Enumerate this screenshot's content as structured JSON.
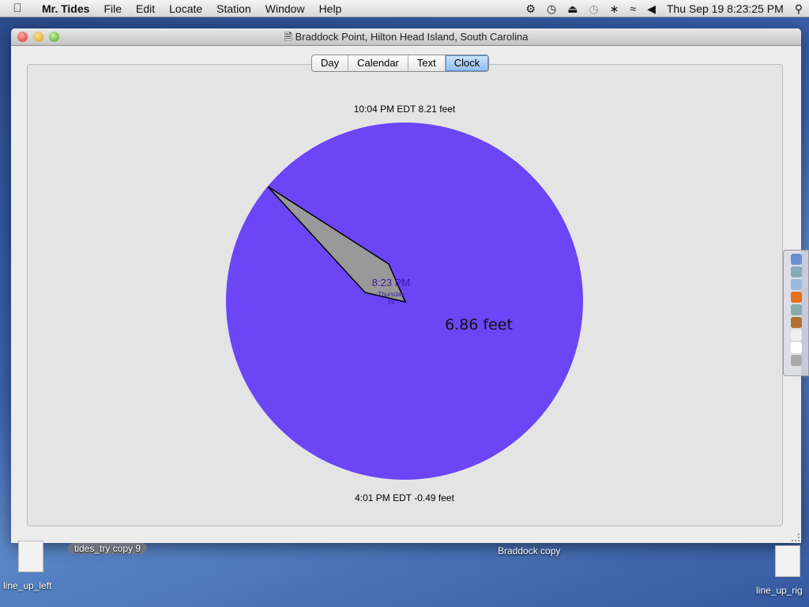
{
  "menubar": {
    "app": "Mr. Tides",
    "items": [
      "File",
      "Edit",
      "Locate",
      "Station",
      "Window",
      "Help"
    ],
    "clock": "Thu Sep 19  8:23:25 PM"
  },
  "window": {
    "title": "Braddock Point, Hilton Head Island, South Carolina"
  },
  "tabs": [
    {
      "label": "Day"
    },
    {
      "label": "Calendar"
    },
    {
      "label": "Text"
    },
    {
      "label": "Clock",
      "selected": true
    }
  ],
  "clock": {
    "high_label": "10:04 PM EDT 8.21 feet",
    "low_label": "4:01 PM EDT -0.49 feet",
    "time": "8:23 PM",
    "weekday": "Thursday",
    "day": "19",
    "height": "6.86 feet",
    "face_color": "#6c45f6",
    "hand_color": "#999999"
  },
  "desktop": {
    "items": [
      "tides_try copy 9",
      "Braddock copy",
      "line_up_left",
      "line_up_rig"
    ]
  }
}
